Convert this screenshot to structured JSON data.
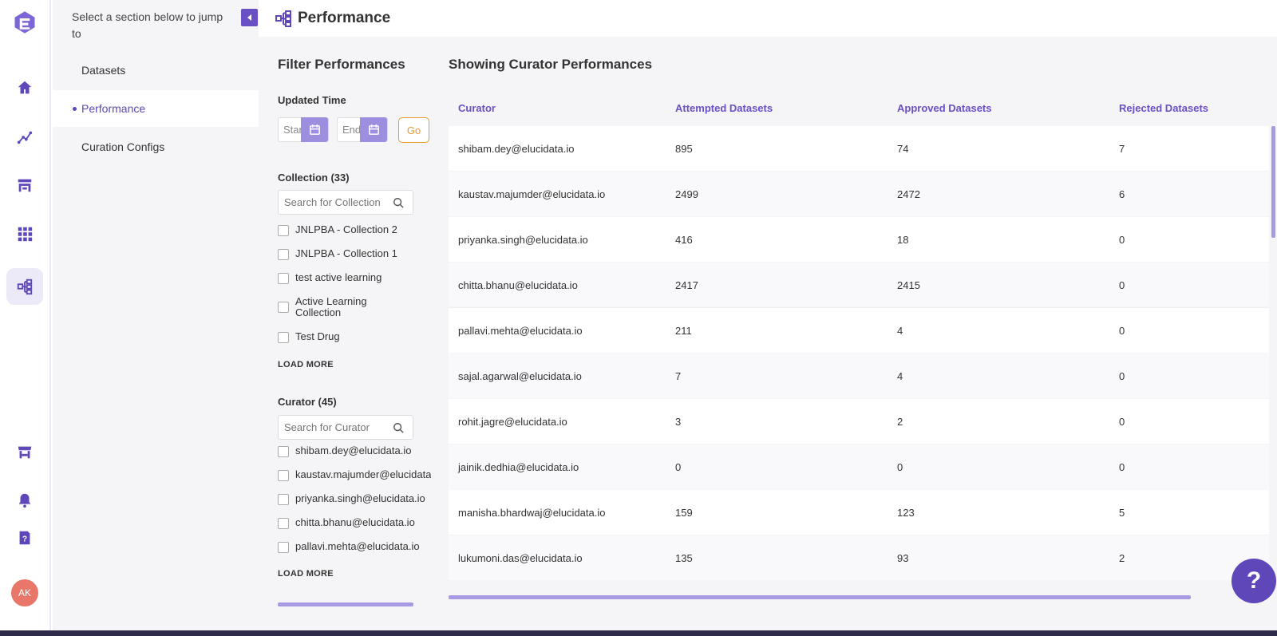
{
  "header": {
    "title": "Performance",
    "icon": "performance-icon"
  },
  "section_nav": {
    "hint": "Select a section below to jump to",
    "items": [
      {
        "label": "Datasets",
        "active": false
      },
      {
        "label": "Performance",
        "active": true
      },
      {
        "label": "Curation Configs",
        "active": false
      }
    ]
  },
  "rail": {
    "icons": [
      "app-logo-icon",
      "home-icon",
      "analytics-icon",
      "workbench-icon",
      "apps-grid-icon",
      "performance-icon",
      "store-icon",
      "bell-icon",
      "help-document-icon"
    ],
    "avatar_initials": "AK"
  },
  "filter": {
    "title": "Filter Performances",
    "updated_time_label": "Updated Time",
    "start_placeholder": "Start",
    "end_placeholder": "End",
    "go_label": "Go",
    "collection": {
      "label": "Collection (33)",
      "search_placeholder": "Search for Collection",
      "options": [
        "JNLPBA - Collection 2",
        "JNLPBA - Collection 1",
        "test active learning",
        "Active Learning Collection",
        "Test Drug"
      ],
      "load_more": "LOAD MORE"
    },
    "curator": {
      "label": "Curator (45)",
      "search_placeholder": "Search for Curator",
      "options": [
        "shibam.dey@elucidata.io",
        "kaustav.majumder@elucidata.io",
        "priyanka.singh@elucidata.io",
        "chitta.bhanu@elucidata.io",
        "pallavi.mehta@elucidata.io"
      ],
      "load_more": "LOAD MORE"
    }
  },
  "table": {
    "title": "Showing Curator Performances",
    "columns": [
      "Curator",
      "Attempted Datasets",
      "Approved Datasets",
      "Rejected Datasets"
    ],
    "rows": [
      [
        "shibam.dey@elucidata.io",
        "895",
        "74",
        "7"
      ],
      [
        "kaustav.majumder@elucidata.io",
        "2499",
        "2472",
        "6"
      ],
      [
        "priyanka.singh@elucidata.io",
        "416",
        "18",
        "0"
      ],
      [
        "chitta.bhanu@elucidata.io",
        "2417",
        "2415",
        "0"
      ],
      [
        "pallavi.mehta@elucidata.io",
        "211",
        "4",
        "0"
      ],
      [
        "sajal.agarwal@elucidata.io",
        "7",
        "4",
        "0"
      ],
      [
        "rohit.jagre@elucidata.io",
        "3",
        "2",
        "0"
      ],
      [
        "jainik.dedhia@elucidata.io",
        "0",
        "0",
        "0"
      ],
      [
        "manisha.bhardwaj@elucidata.io",
        "159",
        "123",
        "5"
      ],
      [
        "lukumoni.das@elucidata.io",
        "135",
        "93",
        "2"
      ]
    ]
  },
  "help_button": "?",
  "colors": {
    "accent": "#5f47b9",
    "accent_light": "#a89ae2",
    "go": "#e89b33",
    "avatar": "#e8776a"
  }
}
